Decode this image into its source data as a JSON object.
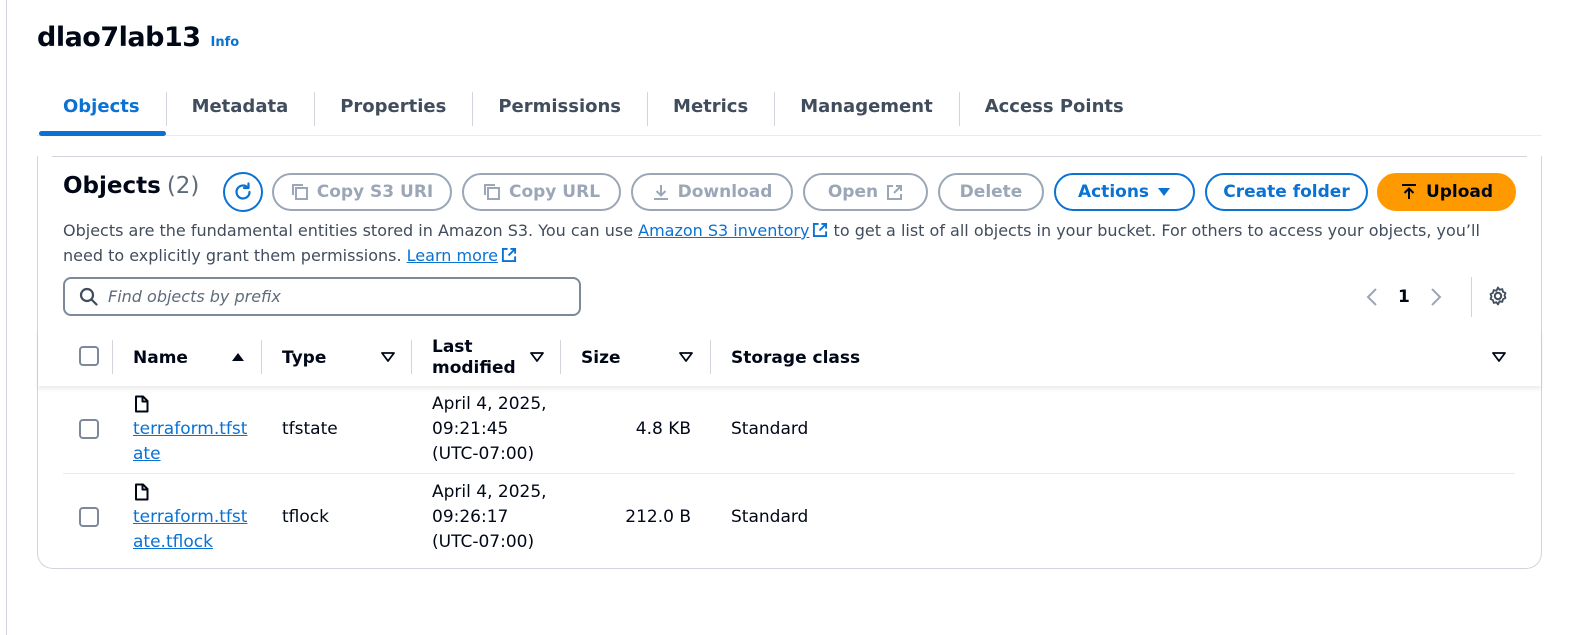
{
  "bucket": {
    "name": "dlao7lab13",
    "info_label": "Info"
  },
  "tabs": [
    {
      "label": "Objects",
      "active": true
    },
    {
      "label": "Metadata"
    },
    {
      "label": "Properties"
    },
    {
      "label": "Permissions"
    },
    {
      "label": "Metrics"
    },
    {
      "label": "Management"
    },
    {
      "label": "Access Points"
    }
  ],
  "objects_panel": {
    "title": "Objects",
    "count": "(2)",
    "buttons": {
      "copy_s3_uri": "Copy S3 URI",
      "copy_url": "Copy URL",
      "download": "Download",
      "open": "Open",
      "delete": "Delete",
      "actions": "Actions",
      "create_folder": "Create folder",
      "upload": "Upload"
    },
    "description": {
      "part1": "Objects are the fundamental entities stored in Amazon S3. You can use ",
      "inventory_link": "Amazon S3 inventory",
      "part2": " to get a list of all objects in your bucket. For others to access your objects, you’ll need to explicitly grant them permissions. ",
      "learn_more": "Learn more"
    },
    "search": {
      "placeholder": "Find objects by prefix",
      "value": ""
    },
    "pagination": {
      "current_page": "1"
    }
  },
  "table": {
    "columns": {
      "name": "Name",
      "type": "Type",
      "last_modified_line1": "Last",
      "last_modified_line2": "modified",
      "size": "Size",
      "storage_class": "Storage class"
    },
    "rows": [
      {
        "name": "terraform.tfstate",
        "type": "tfstate",
        "modified_line1": "April 4, 2025,",
        "modified_line2": "09:21:45",
        "modified_line3": "(UTC-07:00)",
        "size": "4.8 KB",
        "storage_class": "Standard"
      },
      {
        "name": "terraform.tfstate.tflock",
        "type": "tflock",
        "modified_line1": "April 4, 2025,",
        "modified_line2": "09:26:17",
        "modified_line3": "(UTC-07:00)",
        "size": "212.0 B",
        "storage_class": "Standard"
      }
    ]
  },
  "colors": {
    "link_blue": "#0972d3",
    "upload_orange": "#ff9900",
    "disabled_gray": "#9ba7b6",
    "text_dark": "#000716"
  },
  "icons": {
    "refresh": "refresh-icon",
    "copy": "copy-icon",
    "download": "download-icon",
    "external": "external-link-icon",
    "caret": "caret-down-icon",
    "upload": "upload-icon",
    "search": "search-icon",
    "prev": "chevron-left-icon",
    "next": "chevron-right-icon",
    "settings": "gear-icon",
    "file": "file-icon",
    "sort_asc": "sort-ascending-icon",
    "sort": "sort-icon"
  }
}
